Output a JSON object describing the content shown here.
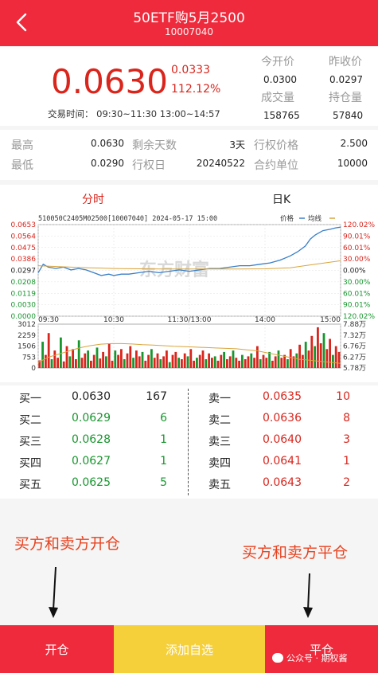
{
  "header": {
    "title": "50ETF购5月2500",
    "code": "10007040"
  },
  "quote": {
    "price": "0.0630",
    "change": "0.0333",
    "change_pct": "112.12%",
    "trade_time": "交易时间：  09:30~11:30 13:00~14:57",
    "open_label": "今开价",
    "open_value": "0.0300",
    "prev_close_label": "昨收价",
    "prev_close_value": "0.0297",
    "volume_label": "成交量",
    "volume_value": "158765",
    "oi_label": "持仓量",
    "oi_value": "57840"
  },
  "stats": {
    "high_label": "最高",
    "high_value": "0.0630",
    "low_label": "最低",
    "low_value": "0.0290",
    "days_label": "剩余天数",
    "days_value": "3天",
    "exdate_label": "行权日",
    "exdate_value": "20240522",
    "strike_label": "行权价格",
    "strike_value": "2.500",
    "unit_label": "合约单位",
    "unit_value": "10000"
  },
  "tabs": {
    "intraday": "分时",
    "kline": "日K"
  },
  "chart": {
    "header_text": "510050C2405M02500[10007040] 2024-05-17 15:00",
    "legend_price": "价格",
    "legend_avg": "均线",
    "watermark": "东方财富",
    "colors": {
      "up": "#d9251c",
      "down": "#18962e",
      "price_line": "#3a7fc8",
      "avg_line": "#d9a43a"
    }
  },
  "chart_data": {
    "type": "line",
    "title": "510050C2405M02500[10007040] 2024-05-17 15:00",
    "x_ticks": [
      "09:30",
      "10:30",
      "11:30/13:00",
      "14:00",
      "15:00"
    ],
    "y_left_ticks": [
      "0.0653",
      "0.0564",
      "0.0475",
      "0.0386",
      "0.0297",
      "0.0208",
      "0.0119",
      "0.0030",
      "0.0000"
    ],
    "y_right_ticks": [
      "120.02%",
      "90.01%",
      "60.01%",
      "30.00%",
      "0.00%",
      "30.00%",
      "60.01%",
      "90.01%",
      "120.02%"
    ],
    "ylim": [
      0.0,
      0.0653
    ],
    "series": [
      {
        "name": "价格",
        "x": [
          0,
          4,
          8,
          14,
          20,
          26,
          32,
          38,
          44,
          50,
          56,
          60,
          66,
          72,
          80,
          88,
          96,
          104,
          112,
          120,
          128,
          136,
          144,
          152,
          160,
          168,
          176,
          184,
          192,
          200,
          206,
          212,
          216,
          220,
          226,
          232,
          236,
          240
        ],
        "values": [
          0.031,
          0.037,
          0.035,
          0.034,
          0.035,
          0.033,
          0.034,
          0.033,
          0.031,
          0.029,
          0.03,
          0.029,
          0.03,
          0.03,
          0.031,
          0.032,
          0.031,
          0.032,
          0.033,
          0.032,
          0.033,
          0.034,
          0.034,
          0.035,
          0.036,
          0.036,
          0.037,
          0.038,
          0.04,
          0.043,
          0.046,
          0.05,
          0.055,
          0.058,
          0.061,
          0.062,
          0.063,
          0.0635
        ]
      },
      {
        "name": "均线",
        "x": [
          0,
          20,
          40,
          60,
          80,
          100,
          120,
          140,
          160,
          180,
          200,
          220,
          240
        ],
        "values": [
          0.036,
          0.0352,
          0.0345,
          0.034,
          0.0338,
          0.0337,
          0.0336,
          0.0336,
          0.0337,
          0.0338,
          0.0345,
          0.037,
          0.0395
        ]
      }
    ]
  },
  "volume_data": {
    "y_left_ticks": [
      "3012",
      "2259",
      "1506",
      "753",
      "0"
    ],
    "y_right_ticks": [
      "7.88万",
      "7.32万",
      "6.76万",
      "6.27万",
      "5.78万"
    ],
    "max": 3012,
    "bars": [
      520,
      1800,
      900,
      2400,
      600,
      1200,
      700,
      2100,
      450,
      1500,
      800,
      1300,
      600,
      1900,
      700,
      1000,
      1200,
      500,
      900,
      1400,
      650,
      1100,
      800,
      1700,
      500,
      1200,
      900,
      1300,
      600,
      1000,
      1500,
      700,
      1200,
      800,
      1100,
      500,
      900,
      1300,
      700,
      1000,
      600,
      800,
      1200,
      400,
      900,
      1100,
      700,
      600,
      1000,
      800,
      1300,
      500,
      700,
      900,
      1200,
      600,
      1000,
      700,
      800,
      500,
      900,
      1100,
      600,
      800,
      1200,
      700,
      500,
      900,
      600,
      800,
      1000,
      700,
      1500,
      600,
      900,
      700,
      1100,
      500,
      800,
      1200,
      700,
      900,
      600,
      1300,
      800,
      1000,
      1600,
      900,
      1800,
      1200,
      2200,
      1500,
      2800,
      1700,
      2400,
      1300,
      2000,
      900,
      1500,
      1100
    ],
    "oi_line": [
      6.05,
      6.3,
      6.45,
      6.6,
      6.75,
      6.85,
      6.92,
      6.95,
      6.95,
      6.93,
      6.9,
      6.88,
      6.85,
      6.82,
      6.8,
      6.78,
      6.76,
      6.74,
      6.72,
      6.7,
      6.65,
      6.6,
      6.5,
      6.4,
      6.3,
      6.2,
      6.15,
      6.1,
      6.05,
      6.0
    ],
    "oi_range": [
      5.78,
      7.88
    ]
  },
  "orderbook": {
    "bids": [
      {
        "label": "买一",
        "price": "0.0630",
        "qty": "167"
      },
      {
        "label": "买二",
        "price": "0.0629",
        "qty": "6"
      },
      {
        "label": "买三",
        "price": "0.0628",
        "qty": "1"
      },
      {
        "label": "买四",
        "price": "0.0627",
        "qty": "1"
      },
      {
        "label": "买五",
        "price": "0.0625",
        "qty": "5"
      }
    ],
    "asks": [
      {
        "label": "卖一",
        "price": "0.0635",
        "qty": "10"
      },
      {
        "label": "卖二",
        "price": "0.0636",
        "qty": "8"
      },
      {
        "label": "卖三",
        "price": "0.0640",
        "qty": "3"
      },
      {
        "label": "卖四",
        "price": "0.0641",
        "qty": "1"
      },
      {
        "label": "卖五",
        "price": "0.0643",
        "qty": "2"
      }
    ]
  },
  "annotations": {
    "left": "买方和卖方开仓",
    "right": "买方和卖方平仓"
  },
  "footer": {
    "open": "开仓",
    "add_watch": "添加自选",
    "close": "平仓",
    "watermark": "公众号 · 期权酱"
  },
  "colors": {
    "brand_red": "#ee2a3c",
    "yellow_btn": "#f5d03a",
    "annot_orange": "#e8421f"
  }
}
